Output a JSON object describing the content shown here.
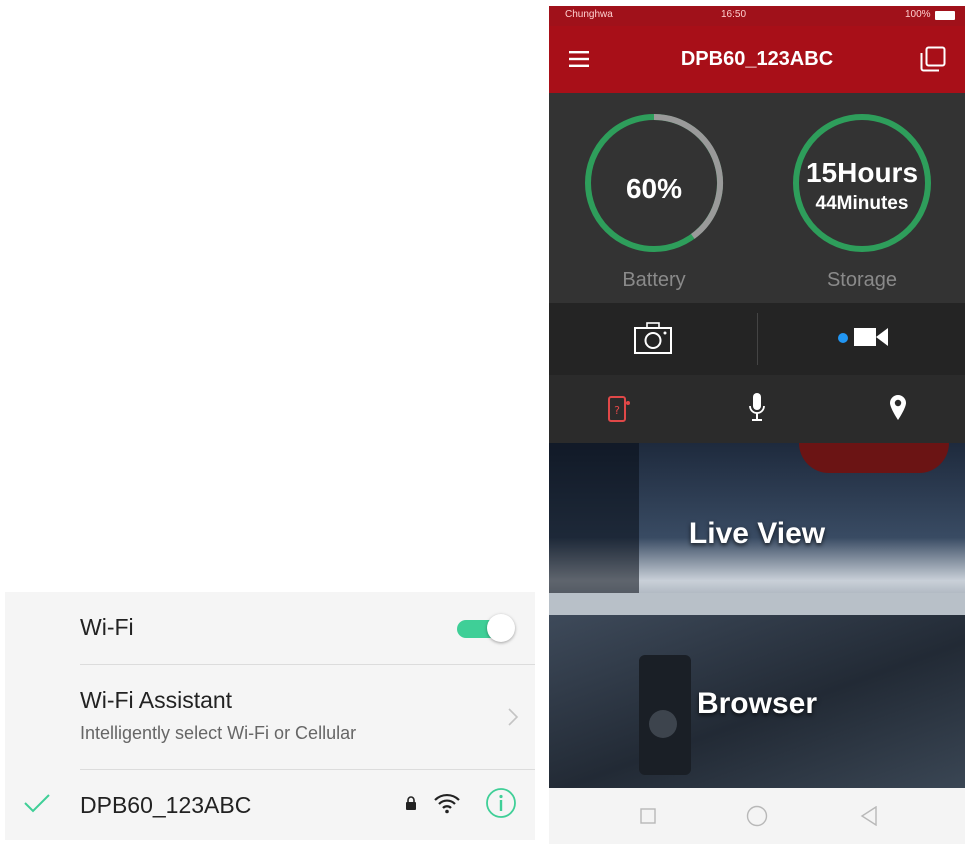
{
  "wifi_settings": {
    "wifi_label": "Wi-Fi",
    "wifi_enabled": true,
    "assistant_title": "Wi-Fi Assistant",
    "assistant_subtitle": "Intelligently select Wi-Fi or Cellular",
    "network_name": "DPB60_123ABC",
    "network_connected": true,
    "colors": {
      "accent": "#3fcf97",
      "info": "#3fcf97"
    },
    "icons": [
      "check-icon",
      "lock-icon",
      "wifi-signal-icon",
      "info-icon",
      "chevron-right-icon"
    ]
  },
  "status_bar": {
    "carrier": "Chunghwa",
    "time": "16:50",
    "battery_text": "100%"
  },
  "app": {
    "title": "DPB60_123ABC",
    "colors": {
      "header": "#a80f18",
      "ring_green": "#2e9e5b",
      "ring_gray": "#9a9a9a",
      "record_dot": "#2196f3"
    },
    "battery": {
      "value_text": "60%",
      "label": "Battery",
      "level": 0.6
    },
    "storage": {
      "hours_text": "15Hours",
      "minutes_text": "44Minutes",
      "label": "Storage"
    },
    "modes": [
      "camera-icon",
      "video-icon"
    ],
    "tools": [
      "device-info-icon",
      "microphone-icon",
      "location-pin-icon"
    ],
    "cards": {
      "live_view": "Live View",
      "browser": "Browser"
    },
    "nav": [
      "square-icon",
      "circle-icon",
      "back-triangle-icon"
    ]
  }
}
